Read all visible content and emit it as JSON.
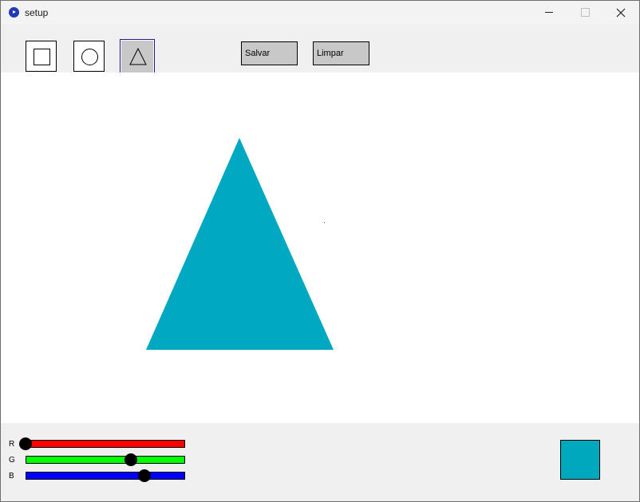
{
  "window": {
    "title": "setup",
    "controls": [
      "minimize-icon",
      "maximize-icon",
      "close-icon"
    ]
  },
  "toolbar": {
    "tools": [
      {
        "name": "rectangle-tool",
        "icon": "square-icon",
        "selected": false
      },
      {
        "name": "circle-tool",
        "icon": "circle-icon",
        "selected": false
      },
      {
        "name": "triangle-tool",
        "icon": "triangle-icon",
        "selected": true
      }
    ],
    "save_label": "Salvar",
    "clear_label": "Limpar"
  },
  "canvas": {
    "shapes": [
      {
        "type": "triangle",
        "fill": "#00a8c2"
      }
    ]
  },
  "sliders": [
    {
      "label": "R",
      "color": "#ff0000",
      "value": 0,
      "max": 255
    },
    {
      "label": "G",
      "color": "#00ff00",
      "value": 168,
      "max": 255
    },
    {
      "label": "B",
      "color": "#0000ff",
      "value": 190,
      "max": 255
    }
  ],
  "preview": {
    "color": "#00a8be"
  }
}
